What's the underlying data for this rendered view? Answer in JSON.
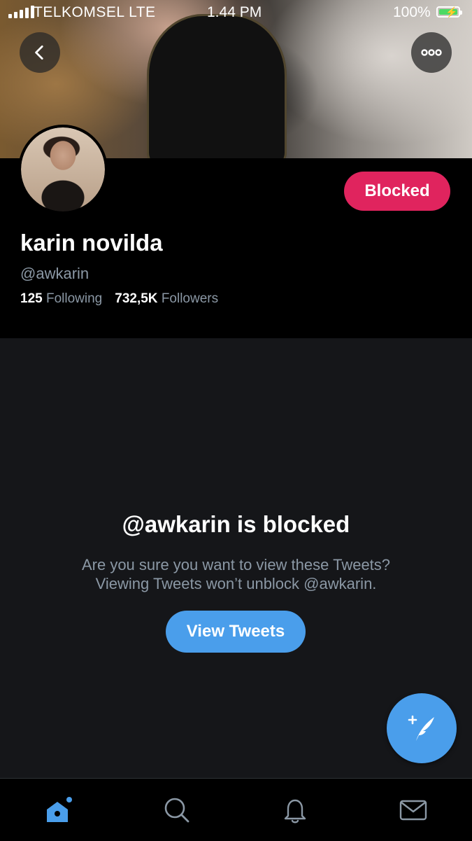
{
  "status_bar": {
    "carrier": "TELKOMSEL  LTE",
    "time": "1.44 PM",
    "battery": "100%"
  },
  "header": {
    "back_icon": "chevron-left-icon",
    "more_icon": "more-horizontal-icon"
  },
  "profile": {
    "name": "karin novilda",
    "handle": "@awkarin",
    "following_count": "125",
    "following_label": "Following",
    "followers_count": "732,5K",
    "followers_label": "Followers",
    "blocked_button": "Blocked",
    "accent": "#e0245e"
  },
  "blocked_notice": {
    "title": "@awkarin is blocked",
    "line1": "Are you sure you want to view these Tweets?",
    "line2": "Viewing Tweets won’t unblock @awkarin.",
    "view_button": "View Tweets",
    "accent": "#4a9eeb"
  },
  "compose": {
    "icon": "compose-tweet-icon"
  },
  "tabbar": {
    "items": [
      {
        "icon": "home-icon",
        "active": true
      },
      {
        "icon": "search-icon",
        "active": false
      },
      {
        "icon": "bell-icon",
        "active": false
      },
      {
        "icon": "mail-icon",
        "active": false
      }
    ]
  }
}
